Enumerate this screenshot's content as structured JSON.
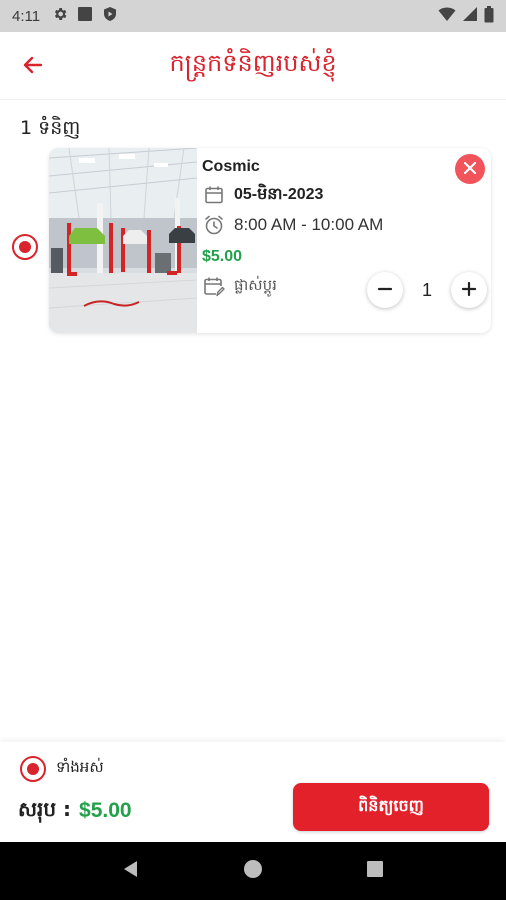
{
  "status_bar": {
    "time": "4:11",
    "icons_left": [
      "gear-icon",
      "square-icon",
      "shield-play-icon"
    ],
    "icons_right": [
      "wifi-icon",
      "signal-icon",
      "battery-icon"
    ]
  },
  "app_bar": {
    "title": "កន្ត្រកទំនិញរបស់ខ្ញុំ",
    "back_icon": "arrow-left-icon"
  },
  "cart": {
    "count_label": "1 ទំនិញ",
    "items": [
      {
        "selected": true,
        "name": "Cosmic",
        "date": "05-មិនា-2023",
        "time": "8:00 AM - 10:00 AM",
        "price": "$5.00",
        "edit_label": "ផ្លាស់ប្តូរ",
        "quantity": "1"
      }
    ]
  },
  "footer": {
    "select_all_label": "ទាំងអស់",
    "total_label": "សរុប :",
    "total_value": "$5.00",
    "checkout_label": "ពិនិត្យចេញ"
  },
  "colors": {
    "primary": "#d9232d",
    "price": "#22a04a",
    "remove": "#f2545b"
  }
}
